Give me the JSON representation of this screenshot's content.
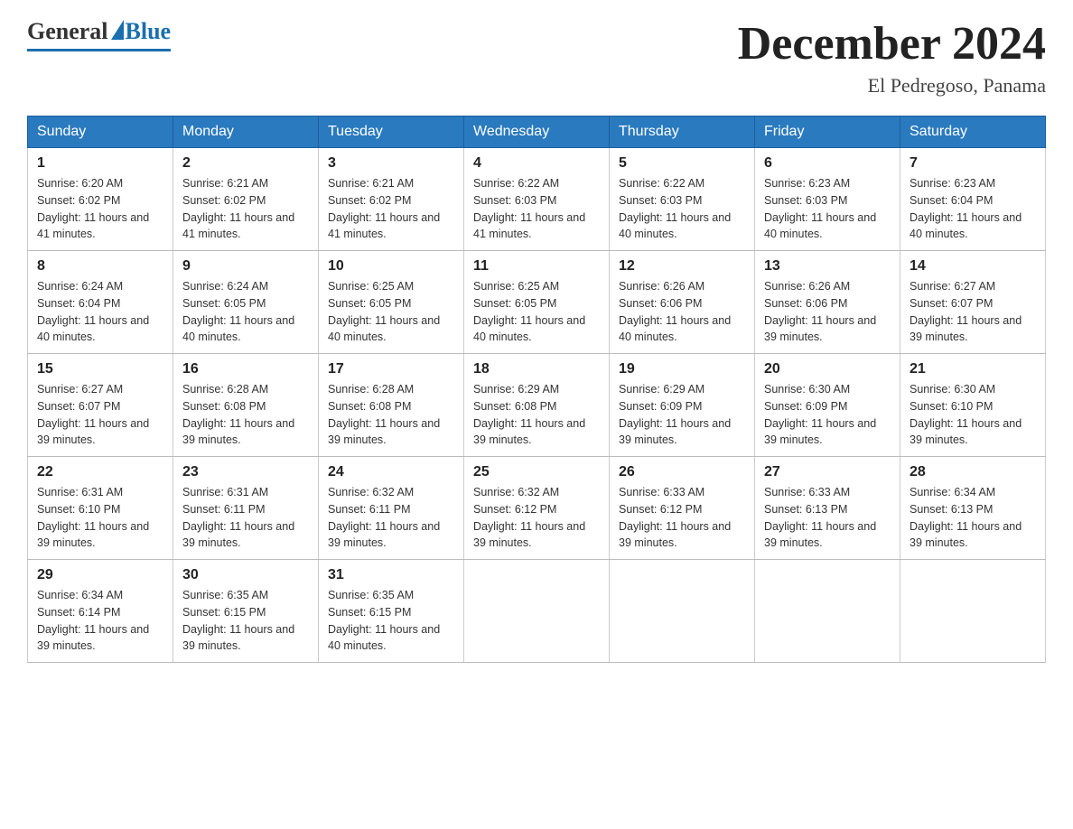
{
  "header": {
    "logo_general": "General",
    "logo_blue": "Blue",
    "month_title": "December 2024",
    "location": "El Pedregoso, Panama"
  },
  "days_of_week": [
    "Sunday",
    "Monday",
    "Tuesday",
    "Wednesday",
    "Thursday",
    "Friday",
    "Saturday"
  ],
  "weeks": [
    [
      {
        "day": "1",
        "sunrise": "6:20 AM",
        "sunset": "6:02 PM",
        "daylight": "11 hours and 41 minutes."
      },
      {
        "day": "2",
        "sunrise": "6:21 AM",
        "sunset": "6:02 PM",
        "daylight": "11 hours and 41 minutes."
      },
      {
        "day": "3",
        "sunrise": "6:21 AM",
        "sunset": "6:02 PM",
        "daylight": "11 hours and 41 minutes."
      },
      {
        "day": "4",
        "sunrise": "6:22 AM",
        "sunset": "6:03 PM",
        "daylight": "11 hours and 41 minutes."
      },
      {
        "day": "5",
        "sunrise": "6:22 AM",
        "sunset": "6:03 PM",
        "daylight": "11 hours and 40 minutes."
      },
      {
        "day": "6",
        "sunrise": "6:23 AM",
        "sunset": "6:03 PM",
        "daylight": "11 hours and 40 minutes."
      },
      {
        "day": "7",
        "sunrise": "6:23 AM",
        "sunset": "6:04 PM",
        "daylight": "11 hours and 40 minutes."
      }
    ],
    [
      {
        "day": "8",
        "sunrise": "6:24 AM",
        "sunset": "6:04 PM",
        "daylight": "11 hours and 40 minutes."
      },
      {
        "day": "9",
        "sunrise": "6:24 AM",
        "sunset": "6:05 PM",
        "daylight": "11 hours and 40 minutes."
      },
      {
        "day": "10",
        "sunrise": "6:25 AM",
        "sunset": "6:05 PM",
        "daylight": "11 hours and 40 minutes."
      },
      {
        "day": "11",
        "sunrise": "6:25 AM",
        "sunset": "6:05 PM",
        "daylight": "11 hours and 40 minutes."
      },
      {
        "day": "12",
        "sunrise": "6:26 AM",
        "sunset": "6:06 PM",
        "daylight": "11 hours and 40 minutes."
      },
      {
        "day": "13",
        "sunrise": "6:26 AM",
        "sunset": "6:06 PM",
        "daylight": "11 hours and 39 minutes."
      },
      {
        "day": "14",
        "sunrise": "6:27 AM",
        "sunset": "6:07 PM",
        "daylight": "11 hours and 39 minutes."
      }
    ],
    [
      {
        "day": "15",
        "sunrise": "6:27 AM",
        "sunset": "6:07 PM",
        "daylight": "11 hours and 39 minutes."
      },
      {
        "day": "16",
        "sunrise": "6:28 AM",
        "sunset": "6:08 PM",
        "daylight": "11 hours and 39 minutes."
      },
      {
        "day": "17",
        "sunrise": "6:28 AM",
        "sunset": "6:08 PM",
        "daylight": "11 hours and 39 minutes."
      },
      {
        "day": "18",
        "sunrise": "6:29 AM",
        "sunset": "6:08 PM",
        "daylight": "11 hours and 39 minutes."
      },
      {
        "day": "19",
        "sunrise": "6:29 AM",
        "sunset": "6:09 PM",
        "daylight": "11 hours and 39 minutes."
      },
      {
        "day": "20",
        "sunrise": "6:30 AM",
        "sunset": "6:09 PM",
        "daylight": "11 hours and 39 minutes."
      },
      {
        "day": "21",
        "sunrise": "6:30 AM",
        "sunset": "6:10 PM",
        "daylight": "11 hours and 39 minutes."
      }
    ],
    [
      {
        "day": "22",
        "sunrise": "6:31 AM",
        "sunset": "6:10 PM",
        "daylight": "11 hours and 39 minutes."
      },
      {
        "day": "23",
        "sunrise": "6:31 AM",
        "sunset": "6:11 PM",
        "daylight": "11 hours and 39 minutes."
      },
      {
        "day": "24",
        "sunrise": "6:32 AM",
        "sunset": "6:11 PM",
        "daylight": "11 hours and 39 minutes."
      },
      {
        "day": "25",
        "sunrise": "6:32 AM",
        "sunset": "6:12 PM",
        "daylight": "11 hours and 39 minutes."
      },
      {
        "day": "26",
        "sunrise": "6:33 AM",
        "sunset": "6:12 PM",
        "daylight": "11 hours and 39 minutes."
      },
      {
        "day": "27",
        "sunrise": "6:33 AM",
        "sunset": "6:13 PM",
        "daylight": "11 hours and 39 minutes."
      },
      {
        "day": "28",
        "sunrise": "6:34 AM",
        "sunset": "6:13 PM",
        "daylight": "11 hours and 39 minutes."
      }
    ],
    [
      {
        "day": "29",
        "sunrise": "6:34 AM",
        "sunset": "6:14 PM",
        "daylight": "11 hours and 39 minutes."
      },
      {
        "day": "30",
        "sunrise": "6:35 AM",
        "sunset": "6:15 PM",
        "daylight": "11 hours and 39 minutes."
      },
      {
        "day": "31",
        "sunrise": "6:35 AM",
        "sunset": "6:15 PM",
        "daylight": "11 hours and 40 minutes."
      },
      null,
      null,
      null,
      null
    ]
  ]
}
